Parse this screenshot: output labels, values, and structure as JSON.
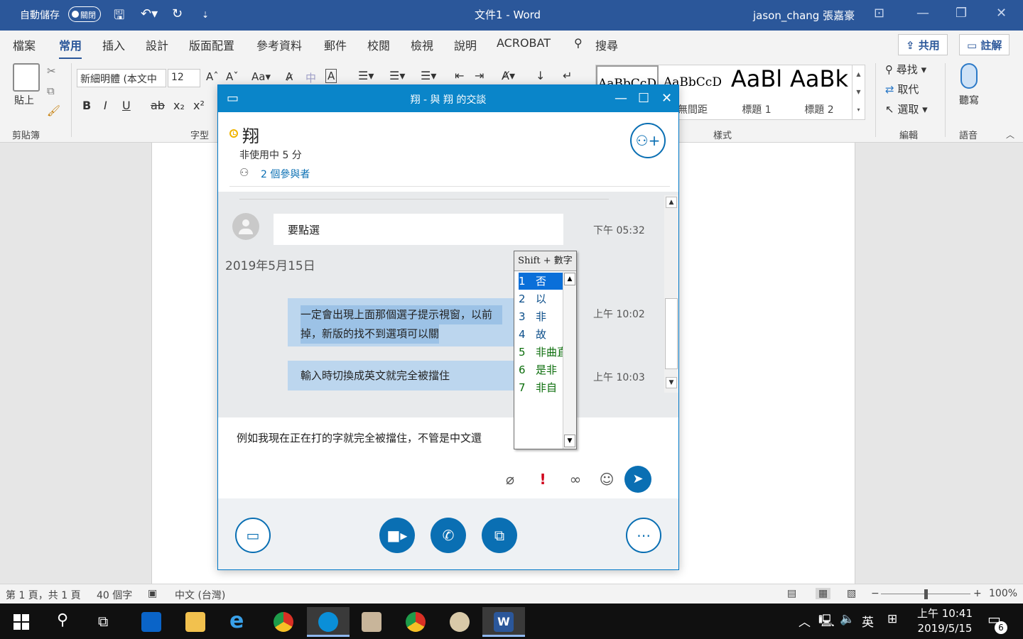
{
  "word": {
    "autosave_label": "自動儲存",
    "autosave_state": "關閉",
    "doc_title": "文件1  -  Word",
    "user": "jason_chang 張嘉豪",
    "tabs": [
      "檔案",
      "常用",
      "插入",
      "設計",
      "版面配置",
      "參考資料",
      "郵件",
      "校閱",
      "檢視",
      "說明",
      "ACROBAT"
    ],
    "search_label": "搜尋",
    "share_label": "共用",
    "comment_label": "註解",
    "paste_label": "貼上",
    "font_name": "新細明體 (本文中",
    "font_size": "12",
    "font_buttons": {
      "bold": "B",
      "italic": "I",
      "underline": "U",
      "strike": "ab",
      "sub": "x₂",
      "sup": "x²"
    },
    "groups": {
      "clipboard": "剪貼簿",
      "font": "字型",
      "styles": "樣式",
      "editing": "編輯",
      "voice": "語音"
    },
    "styles": [
      {
        "sample": "AaBbCcD",
        "name": ""
      },
      {
        "sample": "AaBbCcD",
        "name": "無間距"
      },
      {
        "sample": "AaBl",
        "name": "標題 1"
      },
      {
        "sample": "AaBk",
        "name": "標題 2"
      }
    ],
    "editing": {
      "find": "尋找",
      "replace": "取代",
      "select": "選取"
    },
    "dictate_label": "聽寫",
    "status": {
      "page": "第 1 頁，共 1 頁",
      "words": "40 個字",
      "lang": "中文 (台灣)",
      "zoom": "100%"
    }
  },
  "chat": {
    "window_title": "翔 - 與 翔 的交談",
    "contact_name": "翔",
    "contact_status": "非使用中 5 分",
    "participants": "2 個參與者",
    "messages": [
      {
        "text": "要點選",
        "time": "下午 05:32"
      },
      {
        "text_line1": "一定會出現上面那個選子提示視窗，以前",
        "text_line2": "掉，新版的找不到選項可以關",
        "time": "上午 10:02"
      },
      {
        "text": "輸入時切換成英文就完全被擋住",
        "time": "上午 10:03"
      }
    ],
    "date_separator": "2019年5月15日",
    "compose_text": "例如我現在正在打的字就完全被擋住，不管是中文還"
  },
  "ime": {
    "header": "Shift + 數字",
    "candidates": [
      {
        "num": "1",
        "text": "否"
      },
      {
        "num": "2",
        "text": "以"
      },
      {
        "num": "3",
        "text": "非"
      },
      {
        "num": "4",
        "text": "故"
      },
      {
        "num": "5",
        "text": "非曲直"
      },
      {
        "num": "6",
        "text": "是非"
      },
      {
        "num": "7",
        "text": "非自"
      }
    ]
  },
  "taskbar": {
    "input_lang": "英",
    "time": "上午 10:41",
    "date": "2019/5/15",
    "notifications": "6"
  }
}
